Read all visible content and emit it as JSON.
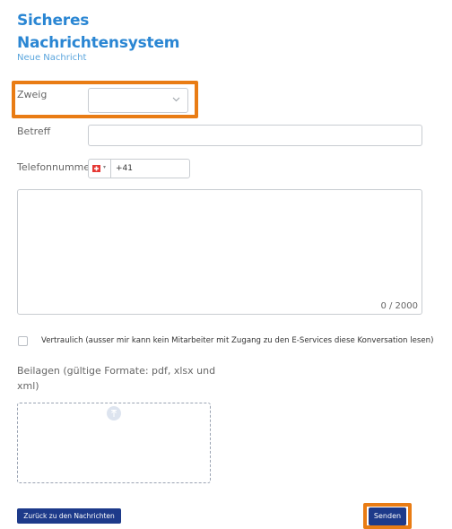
{
  "header": {
    "title_line1": "Sicheres",
    "title_line2": "Nachrichtensystem",
    "subtitle": "Neue Nachricht"
  },
  "form": {
    "branch_label": "Zweig",
    "branch_value": "",
    "subject_label": "Betreff",
    "subject_value": "",
    "phone_label": "Telefonnumme",
    "phone_country_flag": "swiss-flag-icon",
    "phone_value": "+41",
    "message_value": "",
    "message_counter": "0 / 2000",
    "confidential_label": "Vertraulich (ausser mir kann kein Mitarbeiter mit Zugang zu den E-Services diese Konversation lesen)",
    "attachments_label_line1": "Beilagen (gültige Formate: pdf, xlsx und",
    "attachments_label_line2": "xml)"
  },
  "buttons": {
    "back_label": "Zurück zu den Nachrichten",
    "send_label": "Senden"
  },
  "colors": {
    "accent_blue": "#2a86d3",
    "highlight_orange": "#e97c14",
    "button_navy": "#1d3a8a"
  }
}
